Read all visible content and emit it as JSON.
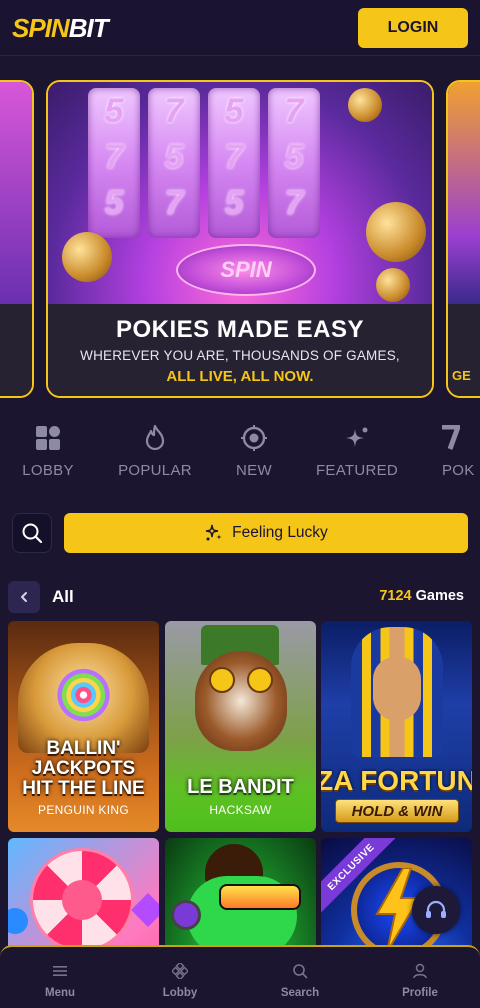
{
  "header": {
    "logo_spin": "SPIN",
    "logo_bit": "BIT",
    "login_label": "LOGIN"
  },
  "banner": {
    "title": "POKIES MADE EASY",
    "subtitle": "WHEREVER YOU ARE, THOUSANDS OF GAMES,",
    "highlight": "ALL LIVE, ALL NOW.",
    "reel_symbols": [
      "5",
      "7",
      "5",
      "7",
      "5",
      "7",
      "5",
      "7",
      "5",
      "7"
    ],
    "spin_label": "SPIN",
    "next_slide_caption": "GE"
  },
  "categories": [
    {
      "label": "LOBBY",
      "icon": "grid-icon"
    },
    {
      "label": "POPULAR",
      "icon": "flame-icon"
    },
    {
      "label": "NEW",
      "icon": "target-icon"
    },
    {
      "label": "FEATURED",
      "icon": "sparkle-icon"
    },
    {
      "label": "POK",
      "icon": "seven-icon"
    }
  ],
  "search": {
    "icon": "search-icon",
    "lucky_label": "Feeling Lucky"
  },
  "section": {
    "title": "All",
    "count": "7124",
    "count_suffix": " Games"
  },
  "games": [
    {
      "title_lines": [
        "BALLIN'",
        "JACKPOTS",
        "HIT THE LINE"
      ],
      "provider": "PENGUIN KING"
    },
    {
      "title_lines": [
        "LE BANDIT"
      ],
      "provider": "HACKSAW"
    },
    {
      "title_lines": [
        "ZA FORTUN",
        "HOLD & WIN"
      ],
      "provider": ""
    },
    {
      "title_lines": [],
      "provider": ""
    },
    {
      "title_lines": [],
      "provider": ""
    },
    {
      "title_lines": [],
      "provider": "",
      "badge": "EXCLUSIVE"
    }
  ],
  "bottom_nav": [
    {
      "label": "Menu",
      "icon": "menu-icon"
    },
    {
      "label": "Lobby",
      "icon": "lobby-icon"
    },
    {
      "label": "Search",
      "icon": "search-icon"
    },
    {
      "label": "Profile",
      "icon": "profile-icon"
    }
  ],
  "colors": {
    "accent": "#f5c518",
    "background": "#1b1530",
    "muted": "#8e8aa3"
  }
}
